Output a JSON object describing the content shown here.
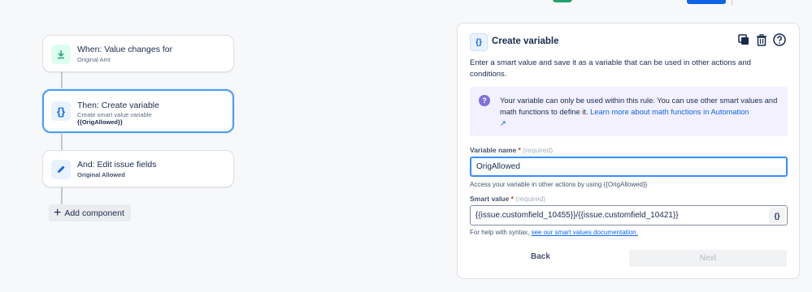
{
  "flow": {
    "trigger": {
      "title": "When: Value changes for",
      "subtitle": "Original Amt"
    },
    "action": {
      "title": "Then: Create variable",
      "subtitle": "Create smart value variable",
      "variable": "{{OrigAllowed}}"
    },
    "edit": {
      "title": "And: Edit issue fields",
      "subtitle": "Original Allowed"
    },
    "add_component_label": "Add component"
  },
  "panel": {
    "icon_text": "{}",
    "title": "Create variable",
    "description": "Enter a smart value and save it as a variable that can be used in other actions and conditions.",
    "info_text": "Your variable can only be used within this rule. You can use other smart values and math functions to define it.",
    "info_link": "Learn more about math functions in Automation",
    "info_link_arrow": "↗",
    "variable_name": {
      "label": "Variable name",
      "required_marker": "*",
      "required_hint": "(required)",
      "value": "OrigAllowed",
      "helper": "Access your variable in other actions by using {{OrigAllowed}}"
    },
    "smart_value": {
      "label": "Smart value",
      "required_marker": "*",
      "required_hint": "(required)",
      "value": "{{issue.customfield_10455}}/{{issue.customfield_10421}}",
      "button_text": "{}",
      "helper_prefix": "For help with syntax,",
      "helper_link": "see our smart values documentation."
    },
    "back_label": "Back",
    "next_label": "Next"
  },
  "colors": {
    "accent": "#0c66e4",
    "trigger_icon": "#22a06b",
    "info_icon": "#8270db",
    "selected_border": "#4c9aff"
  }
}
